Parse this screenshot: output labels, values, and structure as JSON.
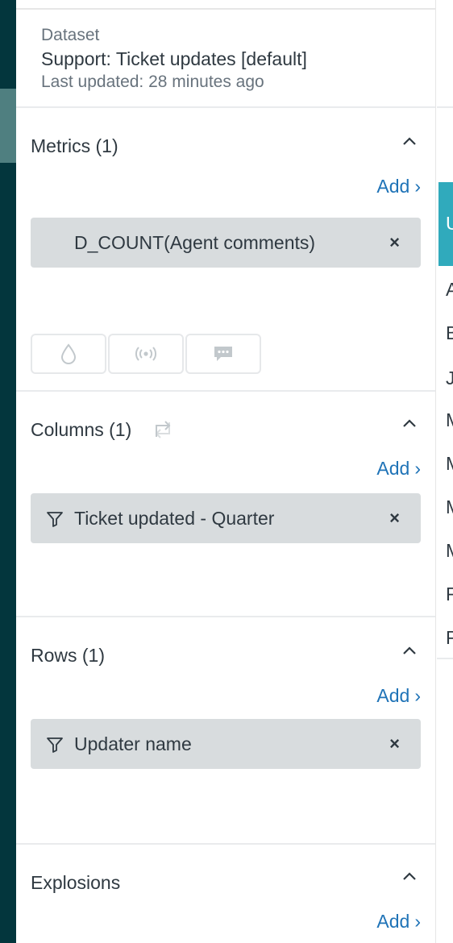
{
  "dataset": {
    "label": "Dataset",
    "name": "Support: Ticket updates [default]",
    "updated": "Last updated: 28 minutes ago"
  },
  "sections": {
    "metrics": {
      "title": "Metrics (1)",
      "add": "Add",
      "pill": "D_COUNT(Agent comments)"
    },
    "columns": {
      "title": "Columns (1)",
      "add": "Add",
      "pill": "Ticket updated - Quarter"
    },
    "rows": {
      "title": "Rows (1)",
      "add": "Add",
      "pill": "Updater name"
    },
    "explosions": {
      "title": "Explosions",
      "add": "Add"
    }
  },
  "viz_buttons": [
    "drop-icon",
    "broadcast-icon",
    "chat-icon"
  ],
  "right_table_cut_letters": [
    "U",
    "A",
    "B",
    "J",
    "M",
    "M",
    "M",
    "M",
    "F",
    "P"
  ],
  "colors": {
    "accent": "#1f73b7",
    "rail": "#03363d",
    "teal": "#30aabc",
    "pill": "#d8dcde"
  }
}
